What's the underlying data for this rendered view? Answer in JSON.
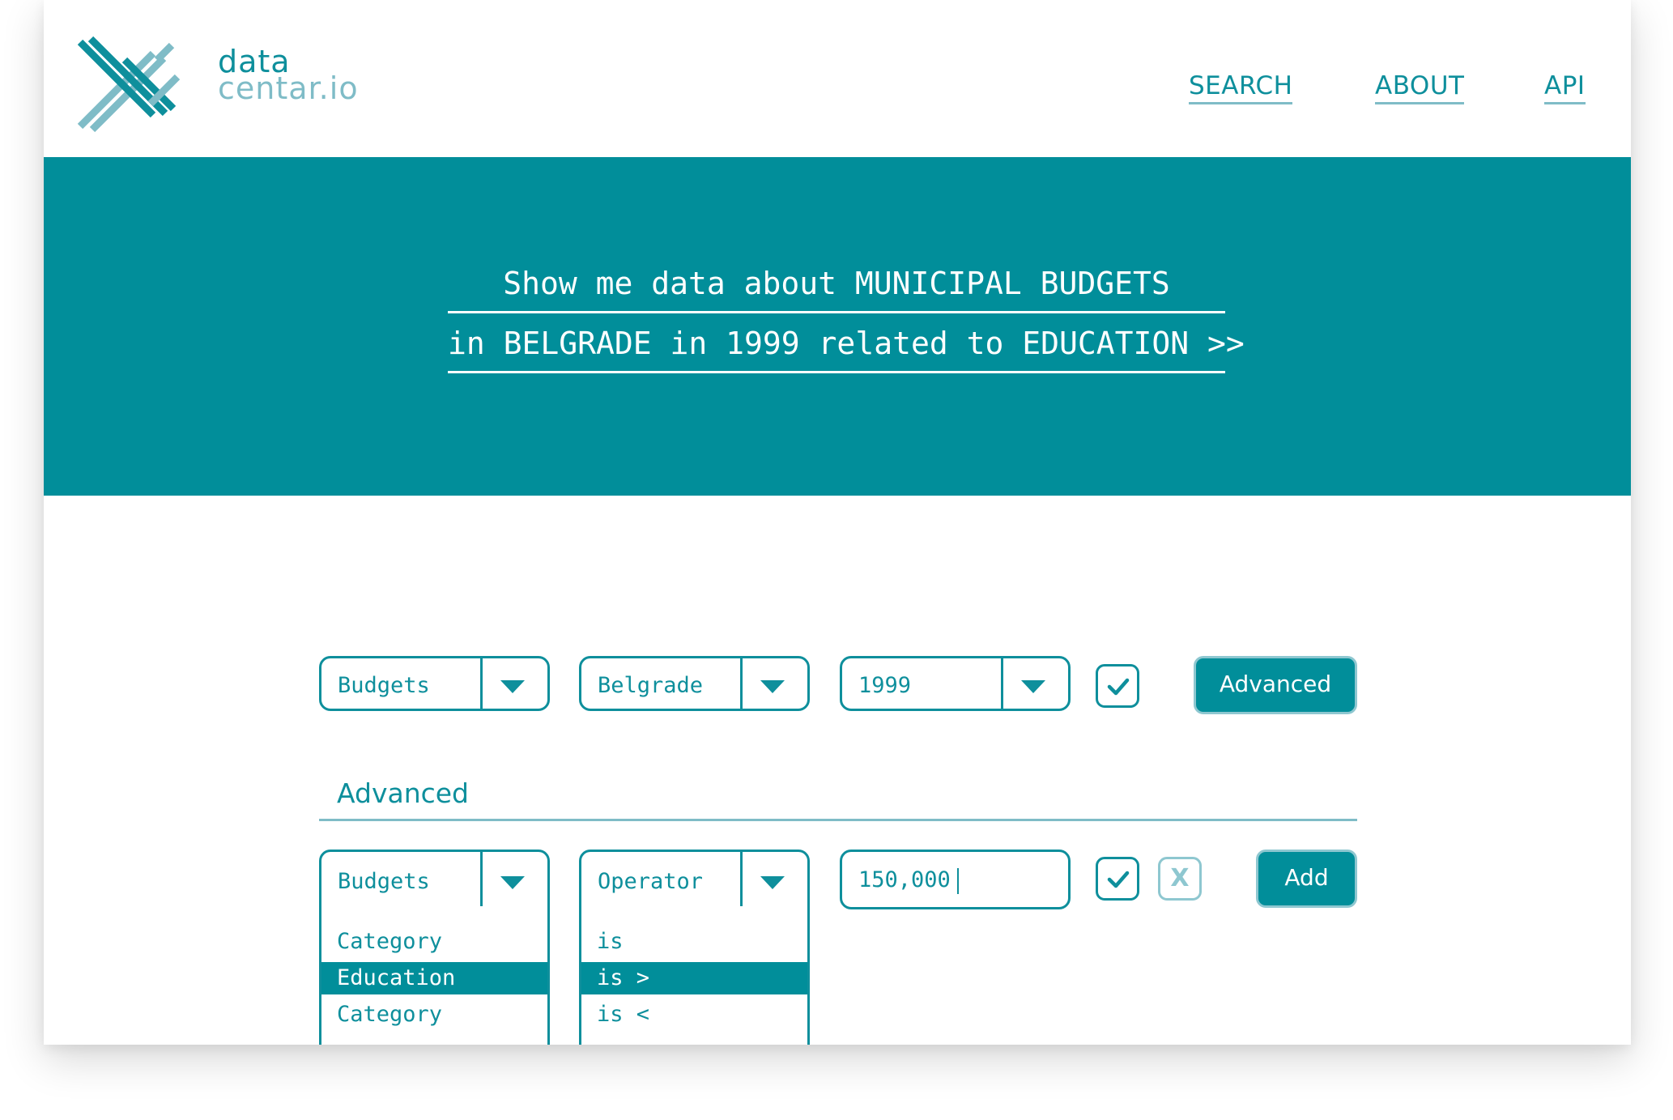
{
  "brand": {
    "name_line1": "data",
    "name_line2": "centar.io"
  },
  "nav": {
    "search": "SEARCH",
    "about": "ABOUT",
    "api": "API"
  },
  "hero": {
    "line1": "Show me data about MUNICIPAL BUDGETS",
    "line2": "in BELGRADE in 1999 related to EDUCATION >>"
  },
  "filters": {
    "dataset": "Budgets",
    "city": "Belgrade",
    "year": "1999",
    "advanced_button": "Advanced"
  },
  "advanced": {
    "title": "Advanced",
    "field_select": "Budgets",
    "field_options": [
      "Category",
      "Education",
      "Category"
    ],
    "field_selected_index": 1,
    "operator_select": "Operator",
    "operator_options": [
      "is",
      "is >",
      "is <"
    ],
    "operator_selected_index": 1,
    "value": "150,000",
    "remove_label": "X",
    "add_button": "Add"
  },
  "colors": {
    "accent": "#018E9A",
    "text": "#0E8F9C",
    "light": "#7FBCC7",
    "background": "#FFFFFF"
  }
}
